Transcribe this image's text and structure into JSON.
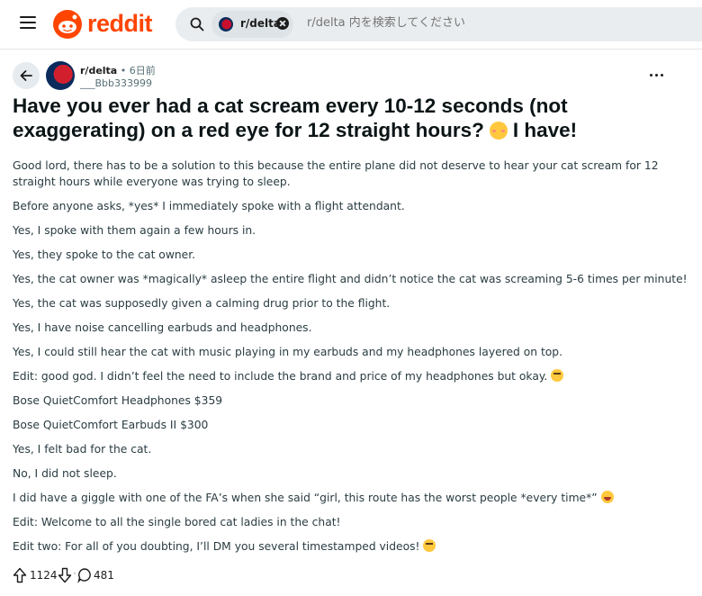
{
  "header": {
    "logo_text": "reddit",
    "brand_color": "#ff4500",
    "search": {
      "chip_label": "r/delta",
      "placeholder": "r/delta 内を検索してください"
    }
  },
  "post": {
    "subreddit": "r/delta",
    "time": " • 6日前",
    "author": "___Bbb333999",
    "title_part1": "Have you ever had a cat scream every 10-12 seconds (not exaggerating) on a red eye for 12 straight hours?",
    "title_part2": "I have!",
    "body": [
      "Good lord, there has to be a solution to this because the entire plane did not deserve to hear your cat scream for 12 straight hours while everyone was trying to sleep.",
      "Before anyone asks, *yes* I immediately spoke with a flight attendant.",
      "Yes, I spoke with them again a few hours in.",
      "Yes, they spoke to the cat owner.",
      "Yes, the cat owner was *magically* asleep the entire flight and didn’t notice the cat was screaming 5-6 times per minute!",
      "Yes, the cat was supposedly given a calming drug prior to the flight.",
      "Yes, I have noise cancelling earbuds and headphones.",
      "Yes, I could still hear the cat with music playing in my earbuds and my headphones layered on top.",
      "Edit: good god. I didn’t feel the need to include the brand and price of my headphones but okay.",
      "Bose QuietComfort Headphones $359",
      "Bose QuietComfort Earbuds II $300",
      "Yes, I felt bad for the cat.",
      "No, I did not sleep.",
      "I did have a giggle with one of the FA’s when she said “girl, this route has the worst people *every time*”",
      "Edit: Welcome to all the single bored cat ladies in the chat!",
      "Edit two: For all of you doubting, I’ll DM you several timestamped videos!"
    ],
    "votes": "1124",
    "comments": "481"
  }
}
